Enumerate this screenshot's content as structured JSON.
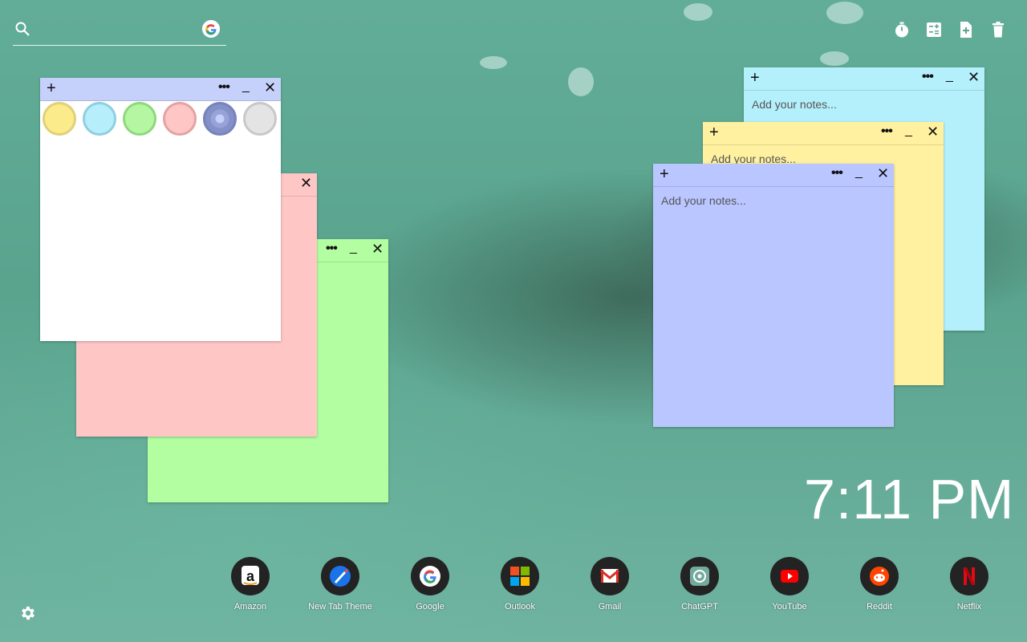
{
  "search": {
    "value": "",
    "placeholder": "",
    "icon": "search-icon",
    "engine_icon": "google-icon"
  },
  "toolbar": {
    "icons": [
      "timer-icon",
      "calculator-icon",
      "add-note-icon",
      "trash-icon"
    ]
  },
  "notes": {
    "placeholder": "Add your notes...",
    "colors": {
      "white": "#ffffff",
      "pink": "#ffc6c6",
      "green": "#b3fea1",
      "cyan": "#b3f0fb",
      "yellow": "#fff19f",
      "blue": "#b9c6ff",
      "palette_bar": "#c5d1fb"
    },
    "palette": [
      "#fbeb8b",
      "#b6effb",
      "#b5f6a3",
      "#ffc6c6",
      "#97a2d9",
      "#e4e4e4"
    ],
    "controls": {
      "add": "+",
      "more": "•••",
      "minimize": "_",
      "close": "✕"
    }
  },
  "clock": {
    "time": "7:11 PM"
  },
  "dock": [
    {
      "label": "Amazon",
      "icon": "amazon-icon"
    },
    {
      "label": "New Tab Theme",
      "icon": "new-tab-theme-icon"
    },
    {
      "label": "Google",
      "icon": "google-icon"
    },
    {
      "label": "Outlook",
      "icon": "outlook-icon"
    },
    {
      "label": "Gmail",
      "icon": "gmail-icon"
    },
    {
      "label": "ChatGPT",
      "icon": "chatgpt-icon"
    },
    {
      "label": "YouTube",
      "icon": "youtube-icon"
    },
    {
      "label": "Reddit",
      "icon": "reddit-icon"
    },
    {
      "label": "Netflix",
      "icon": "netflix-icon"
    }
  ],
  "settings_icon": "gear-icon"
}
